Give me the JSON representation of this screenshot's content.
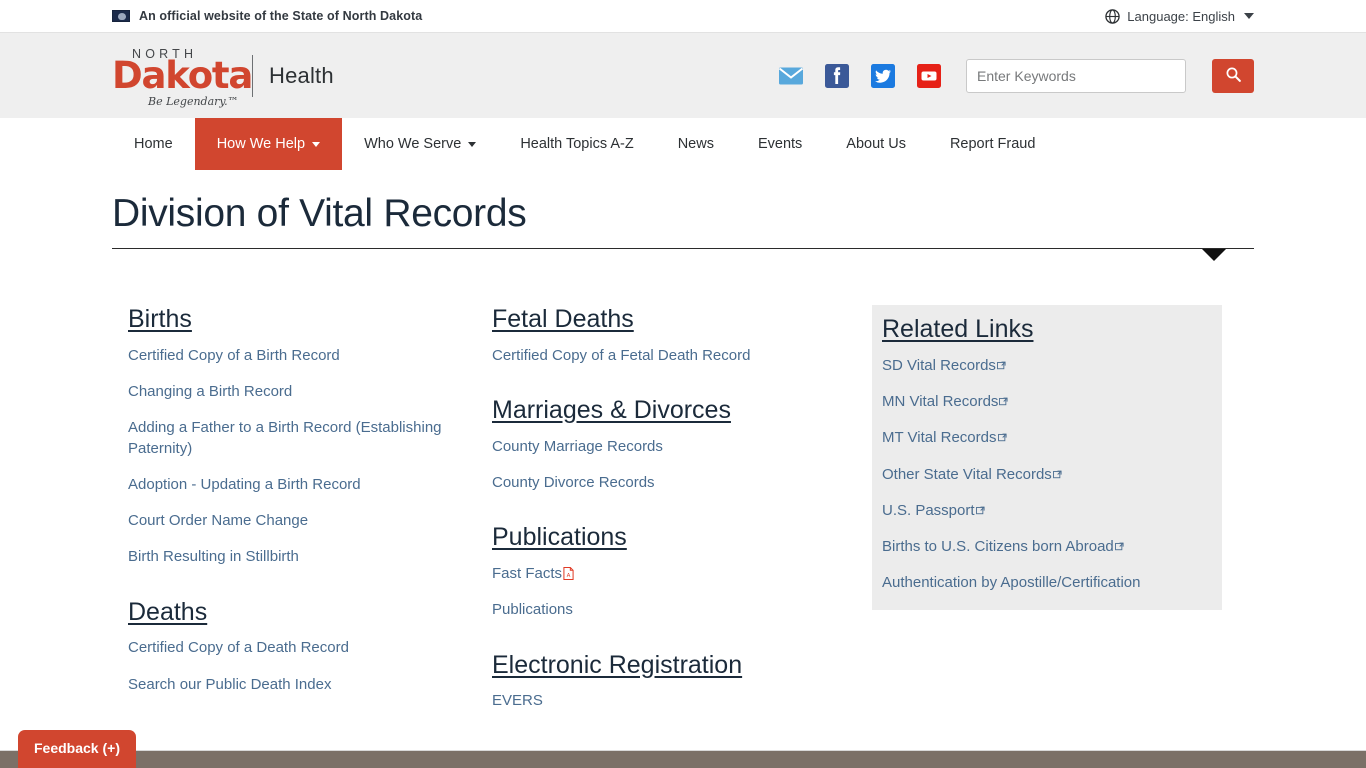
{
  "top_bar": {
    "flag_icon": "north-dakota-flag-icon",
    "official_text": "An official website of the State of North Dakota",
    "globe_icon": "globe-icon",
    "language_label": "Language: English",
    "language_caret_icon": "chevron-down-icon"
  },
  "header": {
    "logo": {
      "north": "NORTH",
      "dakota": "Dakota",
      "tagline": "Be Legendary.™",
      "agency": "Health"
    },
    "social": [
      {
        "name": "email-icon",
        "label": "Email",
        "color": "#58a8dc"
      },
      {
        "name": "facebook-icon",
        "label": "Facebook",
        "color": "#3b5998"
      },
      {
        "name": "twitter-icon",
        "label": "Twitter",
        "color": "#1b7ae0"
      },
      {
        "name": "youtube-icon",
        "label": "YouTube",
        "color": "#e62117"
      }
    ],
    "search": {
      "placeholder": "Enter Keywords",
      "value": "",
      "button_icon": "search-icon",
      "button_color": "#d1462f"
    }
  },
  "nav": {
    "items": [
      {
        "label": "Home",
        "active": false,
        "has_caret": false
      },
      {
        "label": "How We Help",
        "active": true,
        "has_caret": true
      },
      {
        "label": "Who We Serve",
        "active": false,
        "has_caret": true
      },
      {
        "label": "Health Topics A-Z",
        "active": false,
        "has_caret": false
      },
      {
        "label": "News",
        "active": false,
        "has_caret": false
      },
      {
        "label": "Events",
        "active": false,
        "has_caret": false
      },
      {
        "label": "About Us",
        "active": false,
        "has_caret": false
      },
      {
        "label": "Report Fraud",
        "active": false,
        "has_caret": false
      }
    ],
    "active_color": "#d1462f"
  },
  "page": {
    "title": "Division of Vital Records"
  },
  "columns": {
    "col1": {
      "sections": [
        {
          "heading": "Births",
          "links": [
            {
              "label": "Certified Copy of a Birth Record"
            },
            {
              "label": "Changing a Birth Record"
            },
            {
              "label": "Adding a Father to a Birth Record (Establishing Paternity)"
            },
            {
              "label": "Adoption - Updating a Birth Record"
            },
            {
              "label": "Court Order Name Change"
            },
            {
              "label": "Birth Resulting in Stillbirth"
            }
          ]
        },
        {
          "heading": "Deaths",
          "links": [
            {
              "label": "Certified Copy of a Death Record"
            },
            {
              "label": "Search our Public Death Index"
            }
          ]
        }
      ]
    },
    "col2": {
      "sections": [
        {
          "heading": "Fetal Deaths",
          "links": [
            {
              "label": "Certified Copy of a Fetal Death Record"
            }
          ]
        },
        {
          "heading": "Marriages & Divorces",
          "links": [
            {
              "label": "County Marriage Records"
            },
            {
              "label": "County Divorce Records"
            }
          ]
        },
        {
          "heading": "Publications",
          "links": [
            {
              "label": "Fast Facts",
              "pdf": true
            },
            {
              "label": "Publications"
            }
          ]
        },
        {
          "heading": "Electronic Registration",
          "links": [
            {
              "label": "EVERS"
            }
          ]
        }
      ]
    },
    "col3": {
      "heading": "Related Links",
      "links": [
        {
          "label": "SD Vital Records",
          "external": true
        },
        {
          "label": "MN Vital Records",
          "external": true
        },
        {
          "label": "MT Vital Records",
          "external": true
        },
        {
          "label": "Other State Vital Records",
          "external": true
        },
        {
          "label": "U.S. Passport",
          "external": true
        },
        {
          "label": "Births to U.S. Citizens born Abroad",
          "external": true
        },
        {
          "label": "Authentication by Apostille/Certification",
          "external": false
        }
      ],
      "background": "#ececec"
    }
  },
  "feedback": {
    "label": "Feedback (+)",
    "color": "#d1462f"
  },
  "footer": {
    "color": "#7b7067"
  }
}
